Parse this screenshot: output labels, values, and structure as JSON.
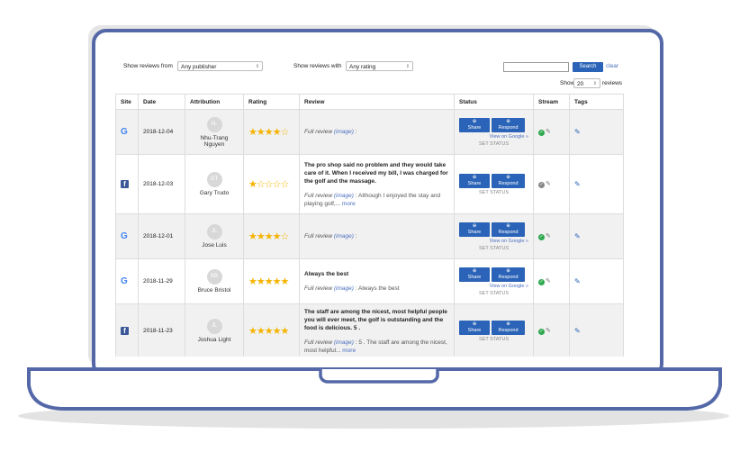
{
  "toolbar": {
    "publisher_label": "Show reviews from",
    "publisher_value": "Any publisher",
    "rating_label": "Show reviews with",
    "rating_value": "Any rating",
    "search_button": "Search",
    "clear_link": "clear",
    "show_label": "Show",
    "show_value": "20",
    "reviews_label": "reviews"
  },
  "table": {
    "headers": [
      "Site",
      "Date",
      "Attribution",
      "Rating",
      "Review",
      "Status",
      "Stream",
      "Tags"
    ],
    "rows": [
      {
        "site": "google",
        "date": "2018-12-04",
        "initials": "N-",
        "name": "Nhu-Trang Nguyen",
        "stars": "★★★★",
        "stars_off": "☆",
        "rating": 4,
        "text": "",
        "full": "Full review",
        "image": "(image)",
        "rest": ":",
        "more": "",
        "stream": "green"
      },
      {
        "site": "facebook",
        "date": "2018-12-03",
        "initials": "GT",
        "name": "Gary Trudo",
        "stars": "★",
        "stars_off": "☆☆☆☆",
        "rating": 1,
        "text": "The pro shop said no problem and they would take care of it. When I received my bill, I was charged for the golf and the massage.",
        "full": "Full review",
        "image": "(image)",
        "rest": ": Although I enjoyed the stay and playing golf,...",
        "more": "more",
        "stream": "grey"
      },
      {
        "site": "google",
        "date": "2018-12-01",
        "initials": "JL",
        "name": "Jose Luis",
        "stars": "★★★★",
        "stars_off": "☆",
        "rating": 4,
        "text": "",
        "full": "Full review",
        "image": "(image)",
        "rest": ":",
        "more": "",
        "stream": "green"
      },
      {
        "site": "google",
        "date": "2018-11-29",
        "initials": "BB",
        "name": "Bruce Bristol",
        "stars": "★★★★★",
        "stars_off": "",
        "rating": 5,
        "text": "Always the best",
        "full": "Full review",
        "image": "(image)",
        "rest": ": Always the best",
        "more": "",
        "stream": "green"
      },
      {
        "site": "facebook",
        "date": "2018-11-23",
        "initials": "JL",
        "name": "Joshua Light",
        "stars": "★★★★★",
        "stars_off": "",
        "rating": 5,
        "text": "The staff are among the nicest, most helpful people you will ever meet, the golf is outstanding and the food is delicious. 5 .",
        "full": "Full review",
        "image": "(image)",
        "rest": ": 5 . The staff are among the nicest, most helpful...",
        "more": "more",
        "stream": "green"
      }
    ],
    "share_label": "Share",
    "respond_label": "Respond",
    "view_google_label": "View on Google »",
    "set_status_label": "SET STATUS"
  },
  "colors": {
    "frame": "#5468a8",
    "button": "#2a63b7",
    "star": "#f5b301",
    "link": "#4a6fbf"
  }
}
